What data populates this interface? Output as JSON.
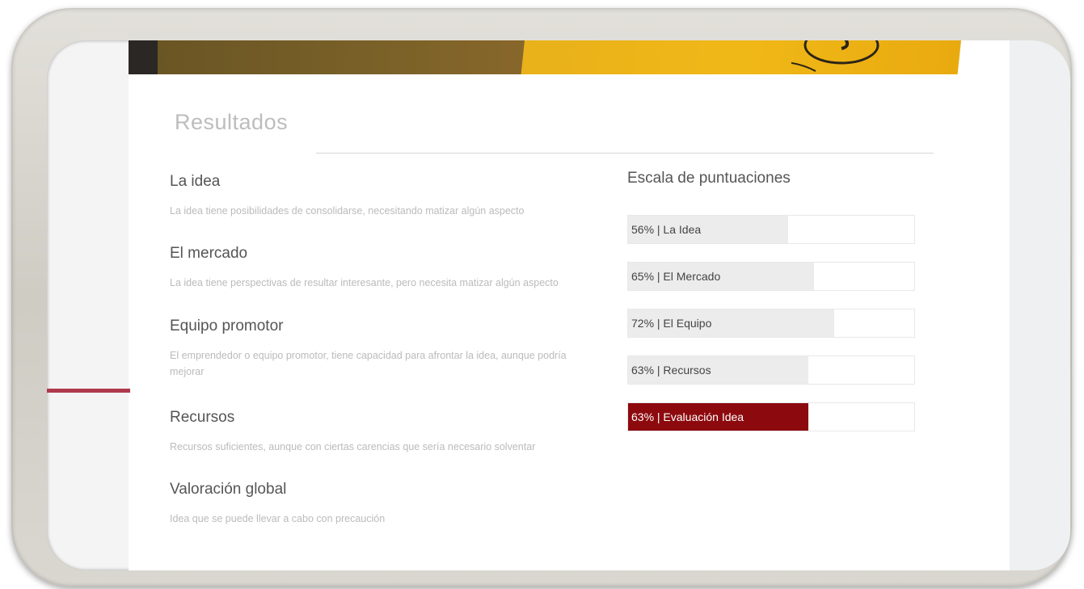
{
  "section": {
    "title": "Resultados"
  },
  "results": [
    {
      "title": "La idea",
      "description": "La idea tiene posibilidades de consolidarse, necesitando matizar algún aspecto"
    },
    {
      "title": "El mercado",
      "description": "La idea tiene perspectivas de resultar interesante, pero necesita matizar algún aspecto"
    },
    {
      "title": "Equipo promotor",
      "description": "El emprendedor o equipo promotor, tiene capacidad para afrontar la idea, aunque podría mejorar"
    },
    {
      "title": "Recursos",
      "description": "Recursos suficientes, aunque con ciertas carencias que sería necesario solventar"
    },
    {
      "title": "Valoración global",
      "description": "Idea que se puede llevar a cabo con precaución"
    }
  ],
  "scale": {
    "title": "Escala de puntuaciones",
    "bars": [
      {
        "label": "56% | La Idea",
        "percent": 56,
        "highlight": false
      },
      {
        "label": "65% | El Mercado",
        "percent": 65,
        "highlight": false
      },
      {
        "label": "72% | El Equipo",
        "percent": 72,
        "highlight": false
      },
      {
        "label": "63% | Recursos",
        "percent": 63,
        "highlight": false
      },
      {
        "label": "63% | Evaluación Idea",
        "percent": 63,
        "highlight": true
      }
    ]
  },
  "colors": {
    "accent_red": "#8c0a0e",
    "side_accent": "#b0394d",
    "bar_fill": "#ececec"
  }
}
